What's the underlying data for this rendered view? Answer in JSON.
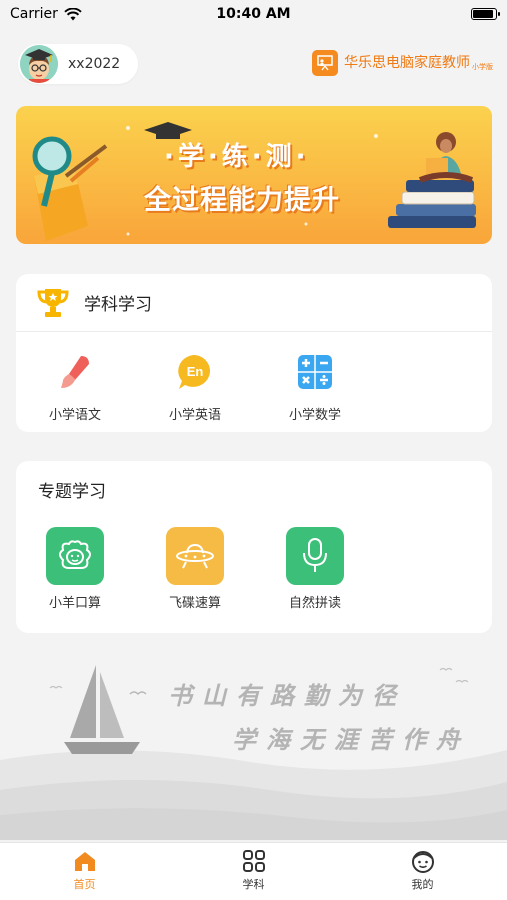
{
  "status_bar": {
    "carrier": "Carrier",
    "time": "10:40 AM",
    "battery_level": 0.9
  },
  "header": {
    "username": "xx2022",
    "brand_name": "华乐思电脑家庭教师",
    "brand_sub": "小学版"
  },
  "banner": {
    "line1": "·学·练·测·",
    "line2": "全过程能力提升"
  },
  "subjects": {
    "title": "学科学习",
    "items": [
      {
        "label": "小学语文",
        "icon": "brush-icon"
      },
      {
        "label": "小学英语",
        "icon": "english-bubble-icon",
        "badge": "En"
      },
      {
        "label": "小学数学",
        "icon": "math-symbols-icon"
      }
    ]
  },
  "topics": {
    "title": "专题学习",
    "items": [
      {
        "label": "小羊口算",
        "icon": "sheep-icon",
        "color": "#3cbf78"
      },
      {
        "label": "飞碟速算",
        "icon": "ufo-icon",
        "color": "#f5bb45"
      },
      {
        "label": "自然拼读",
        "icon": "microphone-icon",
        "color": "#3cbf78"
      }
    ]
  },
  "poem": {
    "line1": "书山有路勤为径",
    "line2": "学海无涯苦作舟"
  },
  "tabbar": {
    "items": [
      {
        "label": "首页",
        "icon": "home-icon",
        "active": true
      },
      {
        "label": "学科",
        "icon": "grid-icon",
        "active": false
      },
      {
        "label": "我的",
        "icon": "face-icon",
        "active": false
      }
    ],
    "active_color": "#f28b1f"
  },
  "colors": {
    "accent": "#f28b1f",
    "background": "#f3f3f3"
  }
}
